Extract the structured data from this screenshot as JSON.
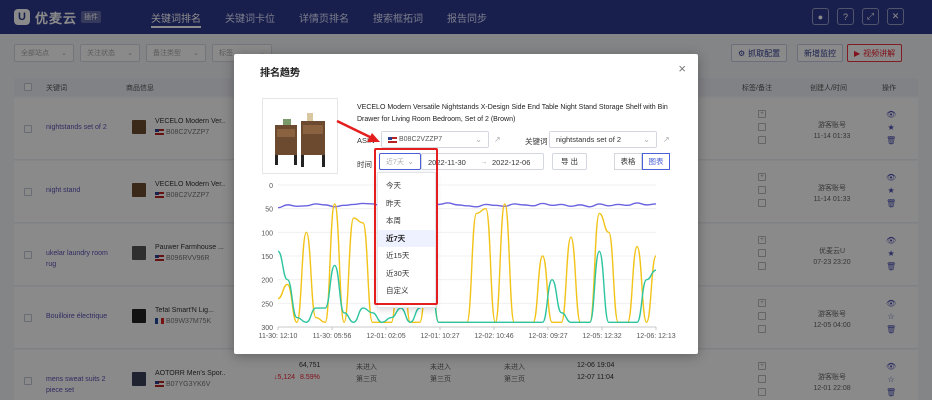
{
  "app": {
    "logo_text": "优麦云",
    "logo_badge": "插件",
    "logo_mark": "U"
  },
  "nav": [
    {
      "label": "关键词排名",
      "active": true
    },
    {
      "label": "关键词卡位",
      "active": false
    },
    {
      "label": "详情页排名",
      "active": false
    },
    {
      "label": "搜索框拓词",
      "active": false
    },
    {
      "label": "报告同步",
      "active": false
    }
  ],
  "filters": [
    {
      "label": "全部站点"
    },
    {
      "label": "关注状态"
    },
    {
      "label": "备注类型"
    },
    {
      "label": "标签"
    }
  ],
  "toolbar": {
    "import_config": "抓取配置",
    "new_monitor": "新增监控",
    "video_tutorial": "视频讲解"
  },
  "table": {
    "headers": {
      "keyword": "关键词",
      "product": "商品信息",
      "tags_notes": "标签/备注",
      "creator": "创建人/时间",
      "ops": "操作"
    },
    "rows": [
      {
        "keyword": "nightstands set of 2",
        "product_name": "VECELO Modern Ver...",
        "asin": "B08C2VZZP7",
        "flag": "us",
        "creator": "游客账号",
        "created": "11-14 01:33"
      },
      {
        "keyword": "night stand",
        "product_name": "VECELO Modern Ver...",
        "asin": "B08C2VZZP7",
        "flag": "us",
        "creator": "游客账号",
        "created": "11-14 01:33"
      },
      {
        "keyword": "ukelar laundry room rug",
        "product_name": "Pauwer Farmhouse ...",
        "asin": "B096RVV96R",
        "flag": "us",
        "creator": "优麦云U",
        "created": "07-23 23:20"
      },
      {
        "keyword": "Bouilloire électrique",
        "product_name": "Tefal Smart'N Lig...",
        "asin": "B09W37M75K",
        "flag": "fr",
        "creator": "游客账号",
        "created": "12-05 04:00"
      },
      {
        "keyword": "mens sweat suits 2 piece set",
        "product_name": "AOTORR Men's Spor...",
        "asin": "B07YG3YK6V",
        "flag": "us",
        "creator": "游客账号",
        "created": "12-01 22:08",
        "rank": "64,751",
        "rank_change": "5,124",
        "rank_pct": "8.59%",
        "status1": "未进入",
        "status2": "第三页",
        "status3": "未进入",
        "status4": "第三页",
        "status5": "未进入",
        "status6": "第三页",
        "update_time": "12-06 19:04",
        "update_time2": "12-07 11:04"
      }
    ]
  },
  "modal": {
    "title": "排名趋势",
    "close": "×",
    "product_title": "VECELO Modern Versatile Nightstands X-Design Side End Table Night Stand Storage Shelf with Bin Drawer for Living Room Bedroom, Set of 2 (Brown)",
    "asin_label": "ASIN",
    "asin_value": "B08C2VZZP7",
    "keyword_label": "关键词",
    "keyword_value": "nightstands set of 2",
    "time_label": "时间",
    "range_placeholder": "近7天",
    "date_start": "2022-11-30",
    "date_arrow": "→",
    "date_end": "2022-12-06",
    "export": "导 出",
    "view_table": "表格",
    "view_chart": "图表",
    "range_options": [
      {
        "label": "今天",
        "selected": false
      },
      {
        "label": "昨天",
        "selected": false
      },
      {
        "label": "本周",
        "selected": false
      },
      {
        "label": "近7天",
        "selected": true
      },
      {
        "label": "近15天",
        "selected": false
      },
      {
        "label": "近30天",
        "selected": false
      },
      {
        "label": "自定义",
        "selected": false
      }
    ]
  },
  "colors": {
    "nav_bg": "#2f3a8f",
    "accent": "#4b5fd8",
    "highlight": "#e41e1e",
    "series_purple": "#6b63e0",
    "series_yellow": "#f2c318",
    "series_teal": "#2ec4a0"
  },
  "chart_data": {
    "type": "line",
    "yticks": [
      "0",
      "50",
      "100",
      "150",
      "200",
      "250",
      "300"
    ],
    "ylim": [
      300,
      0
    ],
    "xticks": [
      "11-30: 12:10",
      "11-30: 05:56",
      "12-01: 02:05",
      "12-01: 10:27",
      "12-02: 10:46",
      "12-03: 09:27",
      "12-05: 12:32",
      "12-06: 12:13"
    ],
    "x_index_range": [
      0,
      40
    ],
    "series": [
      {
        "color": "#6b63e0",
        "values": [
          48,
          42,
          45,
          44,
          40,
          42,
          46,
          43,
          41,
          39,
          40,
          44,
          42,
          45,
          47,
          40,
          43,
          41,
          38,
          42,
          44,
          46,
          41,
          43,
          45,
          40,
          42,
          44,
          39,
          43,
          41,
          45,
          42,
          46,
          40,
          44,
          41,
          43,
          38,
          42,
          40
        ]
      },
      {
        "color": "#f2c318",
        "values": [
          240,
          210,
          290,
          100,
          280,
          290,
          40,
          290,
          70,
          80,
          290,
          290,
          290,
          90,
          290,
          290,
          130,
          290,
          290,
          290,
          290,
          60,
          50,
          290,
          40,
          290,
          290,
          290,
          150,
          290,
          290,
          110,
          290,
          290,
          60,
          100,
          290,
          290,
          130,
          290,
          150
        ]
      },
      {
        "color": "#2ec4a0",
        "values": [
          140,
          200,
          280,
          290,
          260,
          260,
          170,
          270,
          290,
          260,
          270,
          290,
          280,
          260,
          290,
          260,
          140,
          290,
          290,
          290,
          290,
          290,
          290,
          290,
          290,
          290,
          290,
          290,
          290,
          200,
          270,
          290,
          290,
          290,
          140,
          290,
          290,
          290,
          290,
          200,
          180
        ]
      }
    ]
  }
}
